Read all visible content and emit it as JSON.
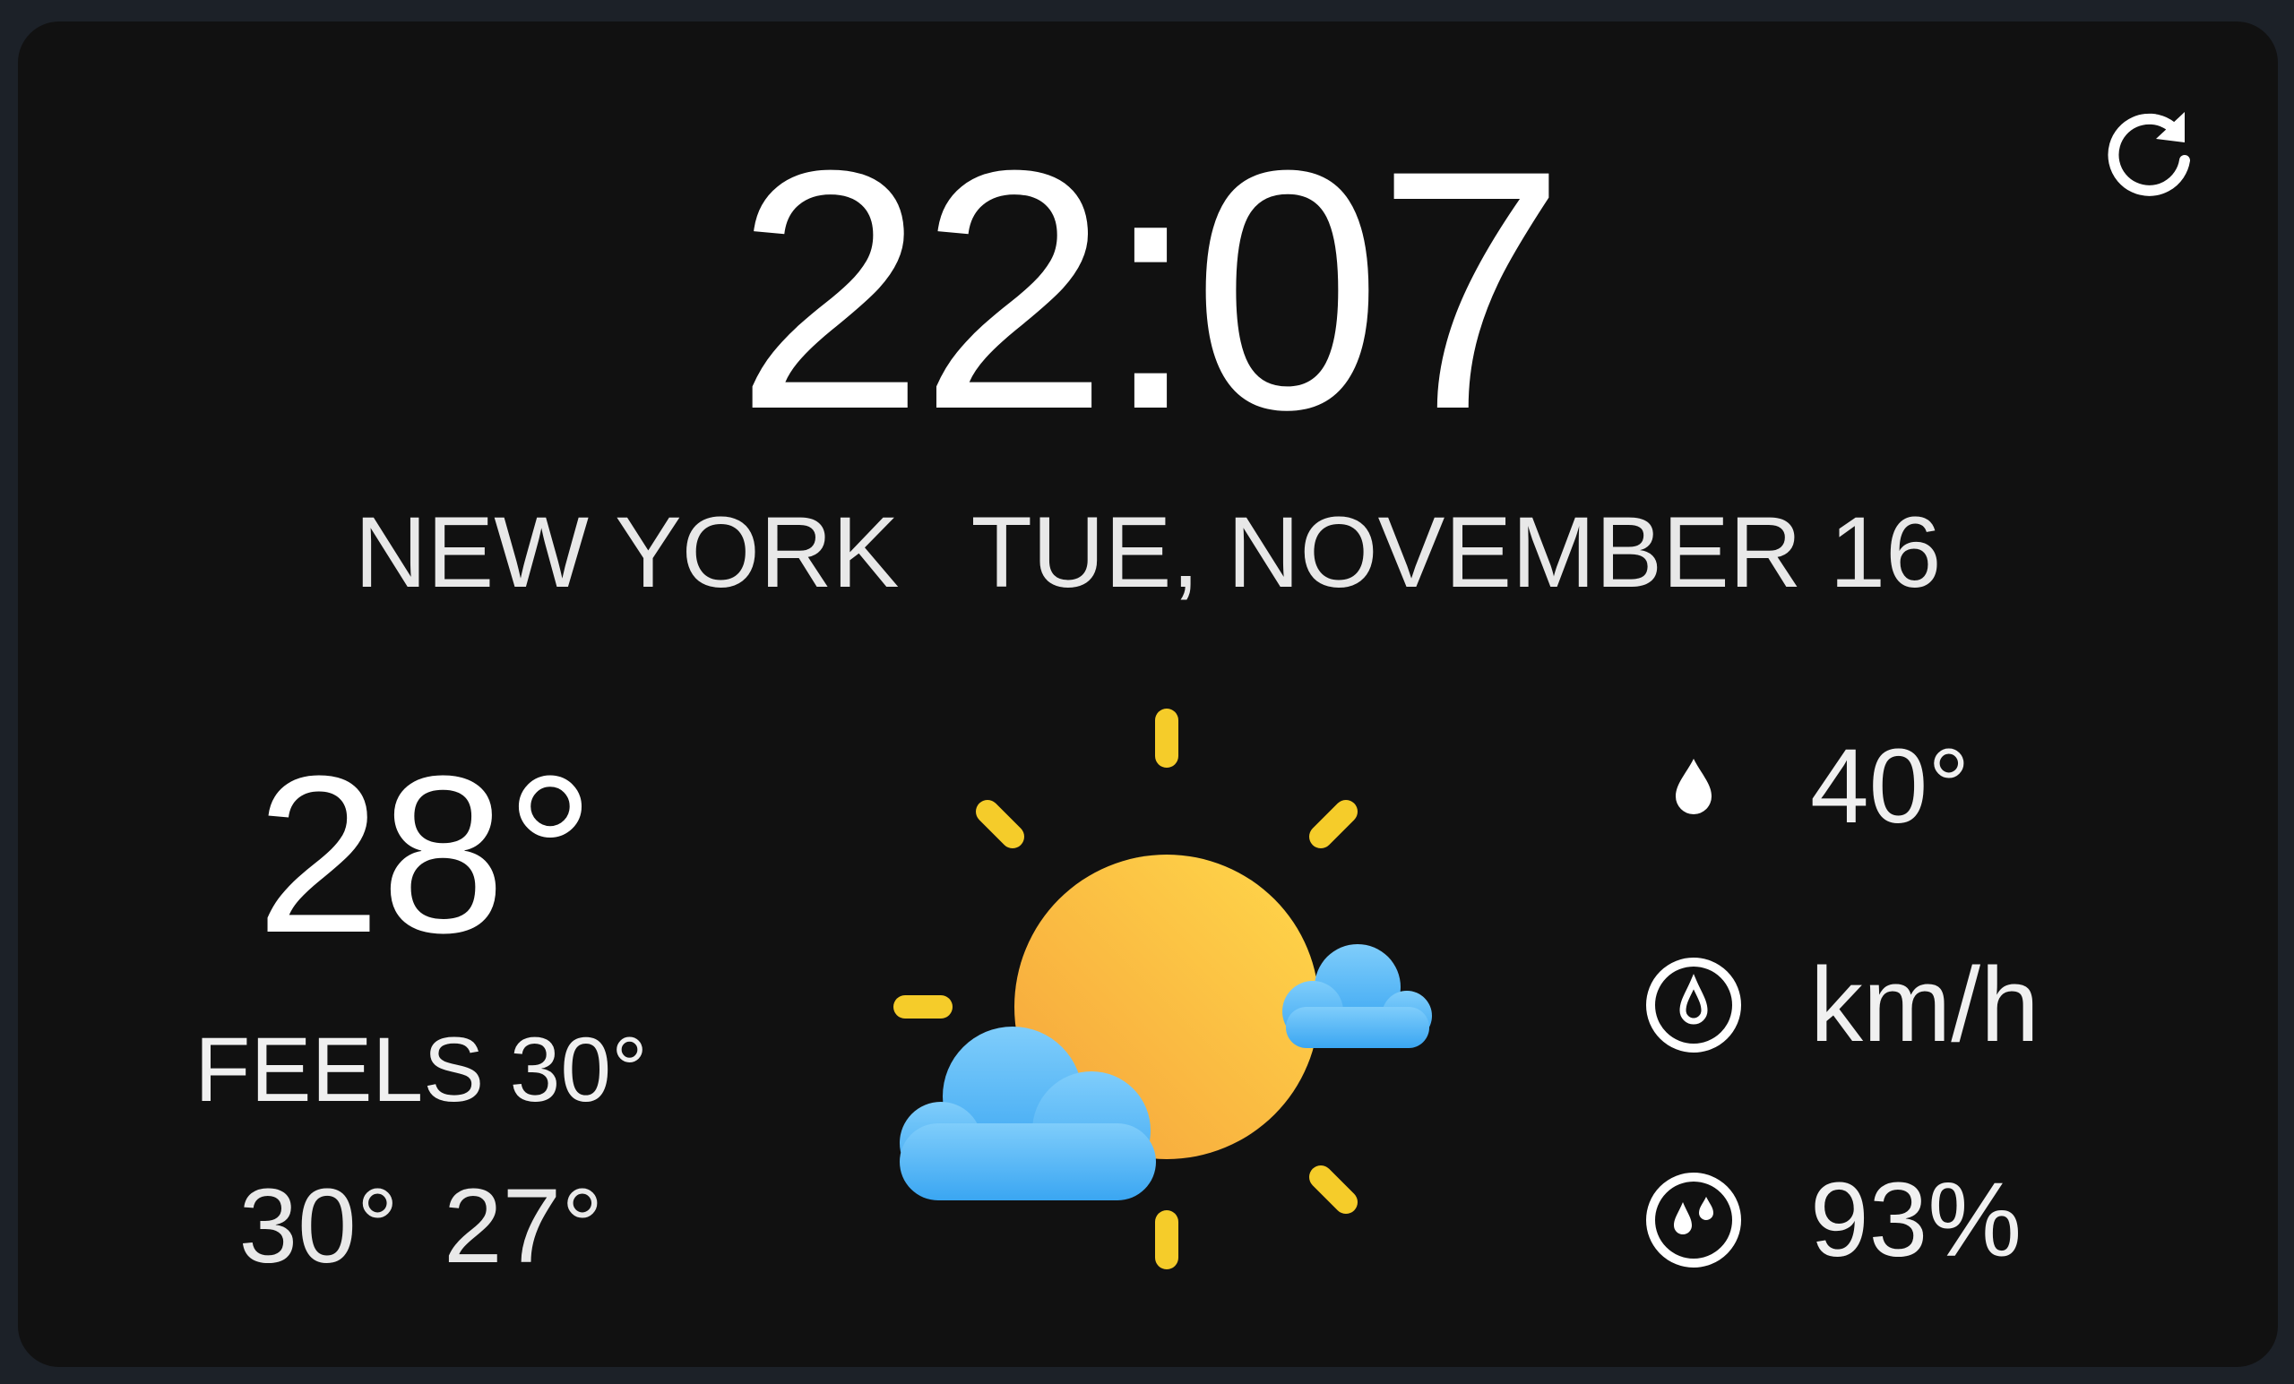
{
  "widget": {
    "time": "22:07",
    "city": "NEW YORK",
    "date": "TUE, NOVEMBER 16",
    "temperature": "28°",
    "feels_like": "FEELS 30°",
    "high": "30°",
    "low": "27°",
    "condition_icon": "partly-sunny-icon",
    "stats": {
      "dew_point": {
        "icon": "droplet-icon",
        "value": "40°"
      },
      "wind": {
        "icon": "wind-gauge-icon",
        "value": "km/h"
      },
      "humidity": {
        "icon": "humidity-icon",
        "value": "93%"
      }
    },
    "refresh_icon": "refresh-icon"
  },
  "colors": {
    "page_background": "#1c2128",
    "card_background": "#111111",
    "text": "#ffffff",
    "sun_light": "#ffd84a",
    "sun_dark": "#f6a23b",
    "ray": "#f5cc2a",
    "cloud_light": "#7fcdfb",
    "cloud_dark": "#3aa6f2"
  }
}
